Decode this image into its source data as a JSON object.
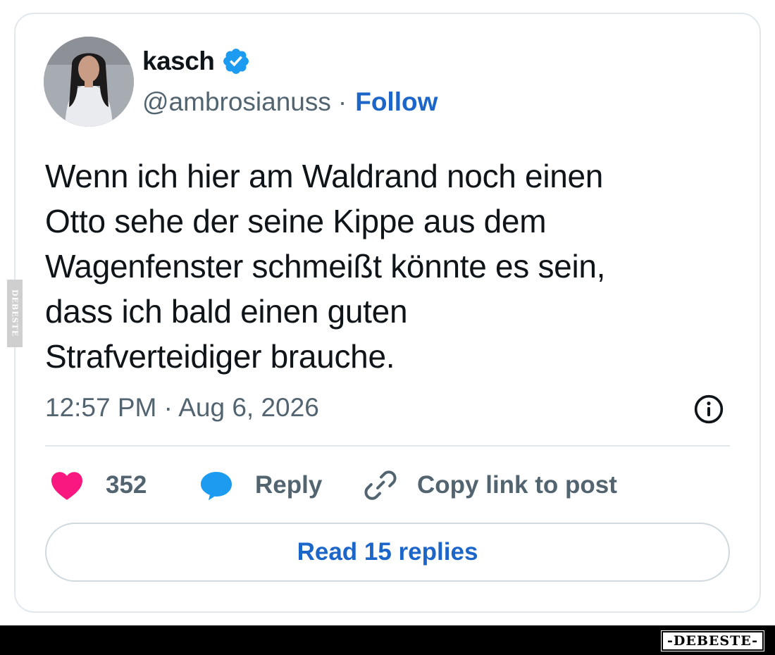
{
  "author": {
    "name": "kasch",
    "handle": "@ambrosianuss",
    "separator": "·",
    "follow_label": "Follow"
  },
  "tweet": {
    "lines": [
      "Wenn ich hier am Waldrand noch einen",
      "Otto sehe der seine Kippe aus dem",
      "Wagenfenster schmeißt könnte es sein,",
      "dass ich bald einen guten",
      "Strafverteidiger brauche."
    ],
    "timestamp": "12:57 PM · Aug 6, 2026"
  },
  "actions": {
    "like_count": "352",
    "reply_label": "Reply",
    "copy_label": "Copy link to post"
  },
  "read_replies_label": "Read 15 replies",
  "watermark": {
    "side": "DEBESTE",
    "bottom": "-DEBESTE-"
  },
  "colors": {
    "like": "#f91880",
    "reply": "#1d9bf0",
    "link": "#1d66c9",
    "muted": "#536471",
    "text": "#0f1419"
  },
  "icons": [
    "verified-badge-icon",
    "info-icon",
    "heart-icon",
    "reply-bubble-icon",
    "link-icon"
  ]
}
